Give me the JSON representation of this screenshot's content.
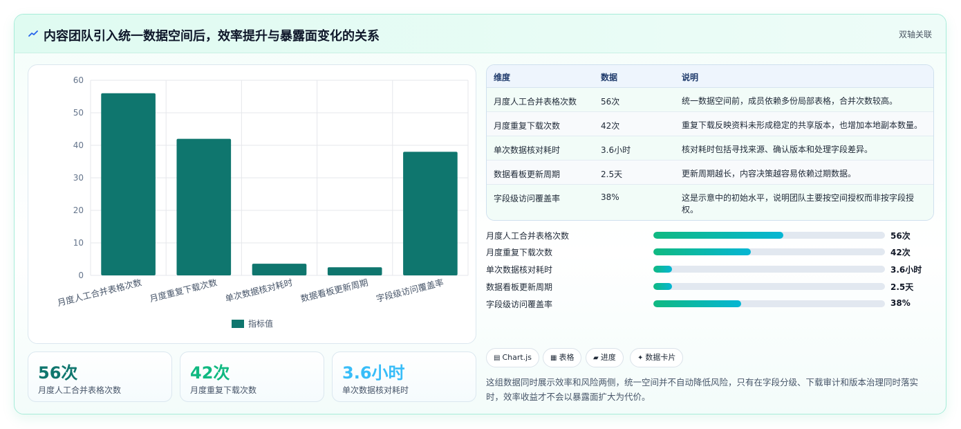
{
  "header": {
    "title": "内容团队引入统一数据空间后，效率提升与暴露面变化的关系",
    "icon": "trend-line-icon",
    "badge": "双轴关联"
  },
  "chart_data": {
    "type": "bar",
    "categories": [
      "月度人工合并表格次数",
      "月度重复下载次数",
      "单次数据核对耗时",
      "数据看板更新周期",
      "字段级访问覆盖率"
    ],
    "series": [
      {
        "name": "指标值",
        "values": [
          56,
          42,
          3.6,
          2.5,
          38
        ],
        "color": "#0f766e"
      }
    ],
    "yticks": [
      "0",
      "10",
      "20",
      "30",
      "40",
      "50",
      "60"
    ],
    "ylim": [
      0,
      60
    ],
    "grid": true,
    "legend": "bottom"
  },
  "kpis": [
    {
      "value": "56次",
      "label": "月度人工合并表格次数",
      "color": "#0f766e"
    },
    {
      "value": "42次",
      "label": "月度重复下载次数",
      "color": "#10b981"
    },
    {
      "value": "3.6小时",
      "label": "单次数据核对耗时",
      "color": "#38bdf8"
    }
  ],
  "table": {
    "headers": [
      "维度",
      "数据",
      "说明"
    ],
    "rows": [
      {
        "dim": "月度人工合并表格次数",
        "data": "56次",
        "desc": "统一数据空间前，成员依赖多份局部表格，合并次数较高。"
      },
      {
        "dim": "月度重复下载次数",
        "data": "42次",
        "desc": "重复下载反映资料未形成稳定的共享版本，也增加本地副本数量。"
      },
      {
        "dim": "单次数据核对耗时",
        "data": "3.6小时",
        "desc": "核对耗时包括寻找来源、确认版本和处理字段差异。"
      },
      {
        "dim": "数据看板更新周期",
        "data": "2.5天",
        "desc": "更新周期越长，内容决策越容易依赖过期数据。"
      },
      {
        "dim": "字段级访问覆盖率",
        "data": "38%",
        "desc": "这是示意中的初始水平，说明团队主要按空间授权而非按字段授权。"
      }
    ]
  },
  "progress": [
    {
      "label": "月度人工合并表格次数",
      "value": "56次",
      "fraction": 0.56
    },
    {
      "label": "月度重复下载次数",
      "value": "42次",
      "fraction": 0.42
    },
    {
      "label": "单次数据核对耗时",
      "value": "3.6小时",
      "fraction": 0.08
    },
    {
      "label": "数据看板更新周期",
      "value": "2.5天",
      "fraction": 0.08
    },
    {
      "label": "字段级访问覆盖率",
      "value": "38%",
      "fraction": 0.38
    }
  ],
  "chips": [
    {
      "icon": "chart-icon",
      "glyph": "▤",
      "label": "Chart.js"
    },
    {
      "icon": "table-icon",
      "glyph": "▦",
      "label": "表格"
    },
    {
      "icon": "progress-icon",
      "glyph": "▰",
      "label": "进度"
    },
    {
      "icon": "sparkle-icon",
      "glyph": "✦",
      "label": "数据卡片"
    }
  ],
  "summary": "这组数据同时展示效率和风险两侧，统一空间并不自动降低风险，只有在字段分级、下载审计和版本治理同时落实时，效率收益才不会以暴露面扩大为代价。"
}
